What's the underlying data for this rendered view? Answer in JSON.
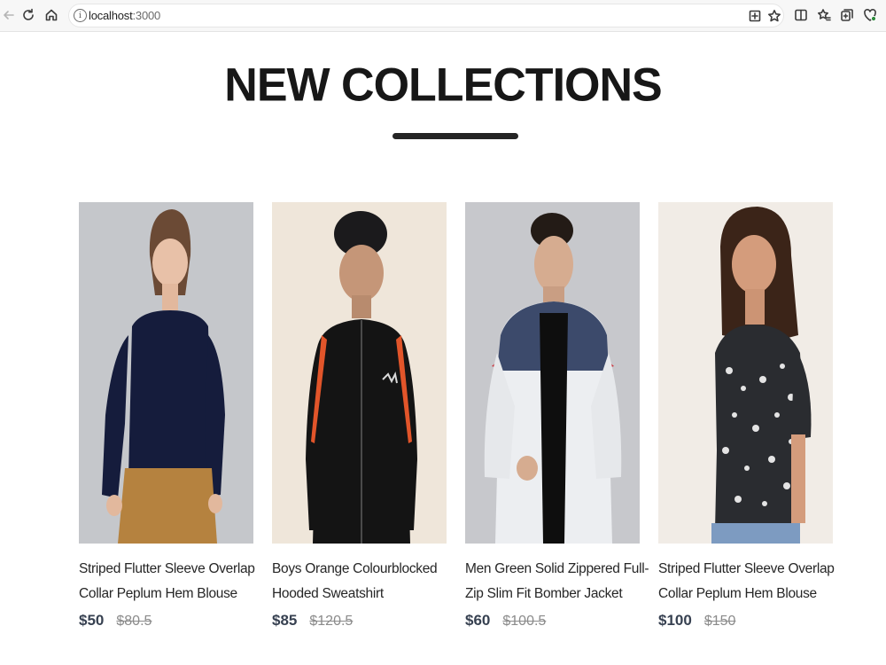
{
  "browser": {
    "url_host": "localhost",
    "url_port": ":3000"
  },
  "page": {
    "title": "NEW COLLECTIONS"
  },
  "products": [
    {
      "name": "Striped Flutter Sleeve Overlap Collar Peplum Hem Blouse",
      "new_price": "$50",
      "old_price": "$80.5",
      "image": "woman-navy-sweater-photo"
    },
    {
      "name": "Boys Orange Colourblocked Hooded Sweatshirt",
      "new_price": "$85",
      "old_price": "$120.5",
      "image": "boy-black-track-jacket-photo"
    },
    {
      "name": "Men Green Solid Zippered Full-Zip Slim Fit Bomber Jacket",
      "new_price": "$60",
      "old_price": "$100.5",
      "image": "man-white-puffer-jacket-photo"
    },
    {
      "name": "Striped Flutter Sleeve Overlap Collar Peplum Hem Blouse",
      "new_price": "$100",
      "old_price": "$150",
      "image": "woman-floral-blouse-photo"
    }
  ],
  "colors": {
    "title": "#171717",
    "price": "#374151",
    "old_price": "#8b8b8b"
  }
}
